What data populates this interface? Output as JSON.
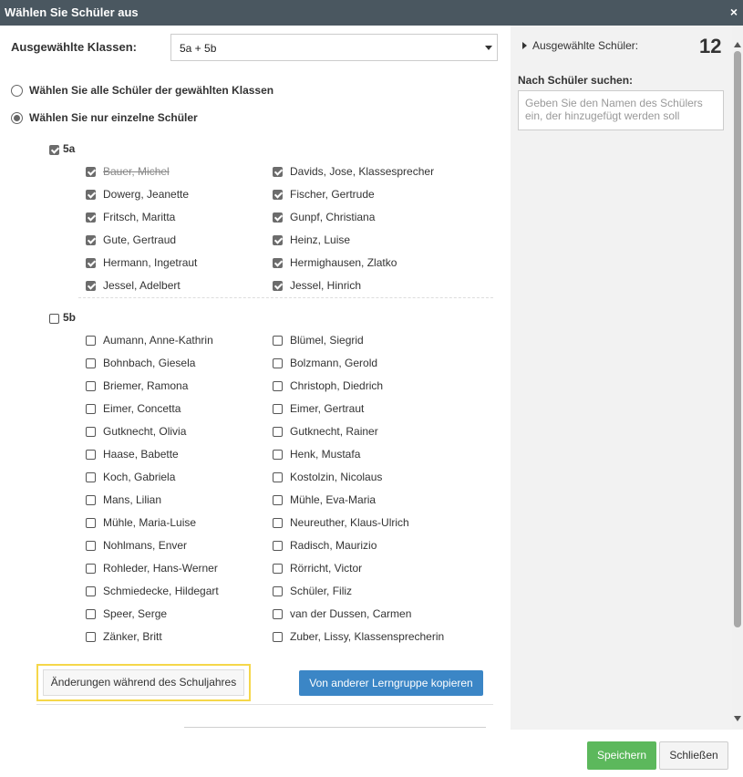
{
  "dialog": {
    "title": "Wählen Sie Schüler aus",
    "close_icon": "×"
  },
  "classes": {
    "label": "Ausgewählte Klassen:",
    "value": "5a + 5b"
  },
  "options": {
    "all": "Wählen Sie alle Schüler der gewählten Klassen",
    "single": "Wählen Sie nur einzelne Schüler",
    "selected": "single"
  },
  "groups": [
    {
      "name": "5a",
      "checked": true,
      "students": [
        {
          "name": "Bauer, Michel",
          "checked": true,
          "strike": true
        },
        {
          "name": "Davids, Jose, Klassesprecher",
          "checked": true
        },
        {
          "name": "Dowerg, Jeanette",
          "checked": true
        },
        {
          "name": "Fischer, Gertrude",
          "checked": true
        },
        {
          "name": "Fritsch, Maritta",
          "checked": true
        },
        {
          "name": "Gunpf, Christiana",
          "checked": true
        },
        {
          "name": "Gute, Gertraud",
          "checked": true
        },
        {
          "name": "Heinz, Luise",
          "checked": true
        },
        {
          "name": "Hermann, Ingetraut",
          "checked": true
        },
        {
          "name": "Hermighausen, Zlatko",
          "checked": true
        },
        {
          "name": "Jessel, Adelbert",
          "checked": true
        },
        {
          "name": "Jessel, Hinrich",
          "checked": true
        }
      ]
    },
    {
      "name": "5b",
      "checked": false,
      "students": [
        {
          "name": "Aumann, Anne-Kathrin",
          "checked": false
        },
        {
          "name": "Blümel, Siegrid",
          "checked": false
        },
        {
          "name": "Bohnbach, Giesela",
          "checked": false
        },
        {
          "name": "Bolzmann, Gerold",
          "checked": false
        },
        {
          "name": "Briemer, Ramona",
          "checked": false
        },
        {
          "name": "Christoph, Diedrich",
          "checked": false
        },
        {
          "name": "Eimer, Concetta",
          "checked": false
        },
        {
          "name": "Eimer, Gertraut",
          "checked": false
        },
        {
          "name": "Gutknecht, Olivia",
          "checked": false
        },
        {
          "name": "Gutknecht, Rainer",
          "checked": false
        },
        {
          "name": "Haase, Babette",
          "checked": false
        },
        {
          "name": "Henk, Mustafa",
          "checked": false
        },
        {
          "name": "Koch, Gabriela",
          "checked": false
        },
        {
          "name": "Kostolzin, Nicolaus",
          "checked": false
        },
        {
          "name": "Mans, Lilian",
          "checked": false
        },
        {
          "name": "Mühle, Eva-Maria",
          "checked": false
        },
        {
          "name": "Mühle, Maria-Luise",
          "checked": false
        },
        {
          "name": "Neureuther, Klaus-Ulrich",
          "checked": false
        },
        {
          "name": "Nohlmans, Enver",
          "checked": false
        },
        {
          "name": "Radisch, Maurizio",
          "checked": false
        },
        {
          "name": "Rohleder, Hans-Werner",
          "checked": false
        },
        {
          "name": "Rörricht, Victor",
          "checked": false
        },
        {
          "name": "Schmiedecke, Hildegart",
          "checked": false
        },
        {
          "name": "Schüler, Filiz",
          "checked": false
        },
        {
          "name": "Speer, Serge",
          "checked": false
        },
        {
          "name": "van der Dussen, Carmen",
          "checked": false
        },
        {
          "name": "Zänker, Britt",
          "checked": false
        },
        {
          "name": "Zuber, Lissy, Klassensprecherin",
          "checked": false
        }
      ]
    }
  ],
  "buttons": {
    "changes": "Änderungen während des Schuljahres",
    "copy": "Von anderer Lerngruppe kopieren",
    "save": "Speichern",
    "close": "Schließen"
  },
  "sidebar": {
    "selected_label": "Ausgewählte Schüler:",
    "count": "12",
    "search_label": "Nach Schüler suchen:",
    "search_placeholder": "Geben Sie den Namen des Schülers ein, der hinzugefügt werden soll"
  },
  "colors": {
    "titlebar": "#4a5760",
    "primary": "#3b86c6",
    "success": "#5cb85c",
    "highlight": "#f5d74a"
  }
}
